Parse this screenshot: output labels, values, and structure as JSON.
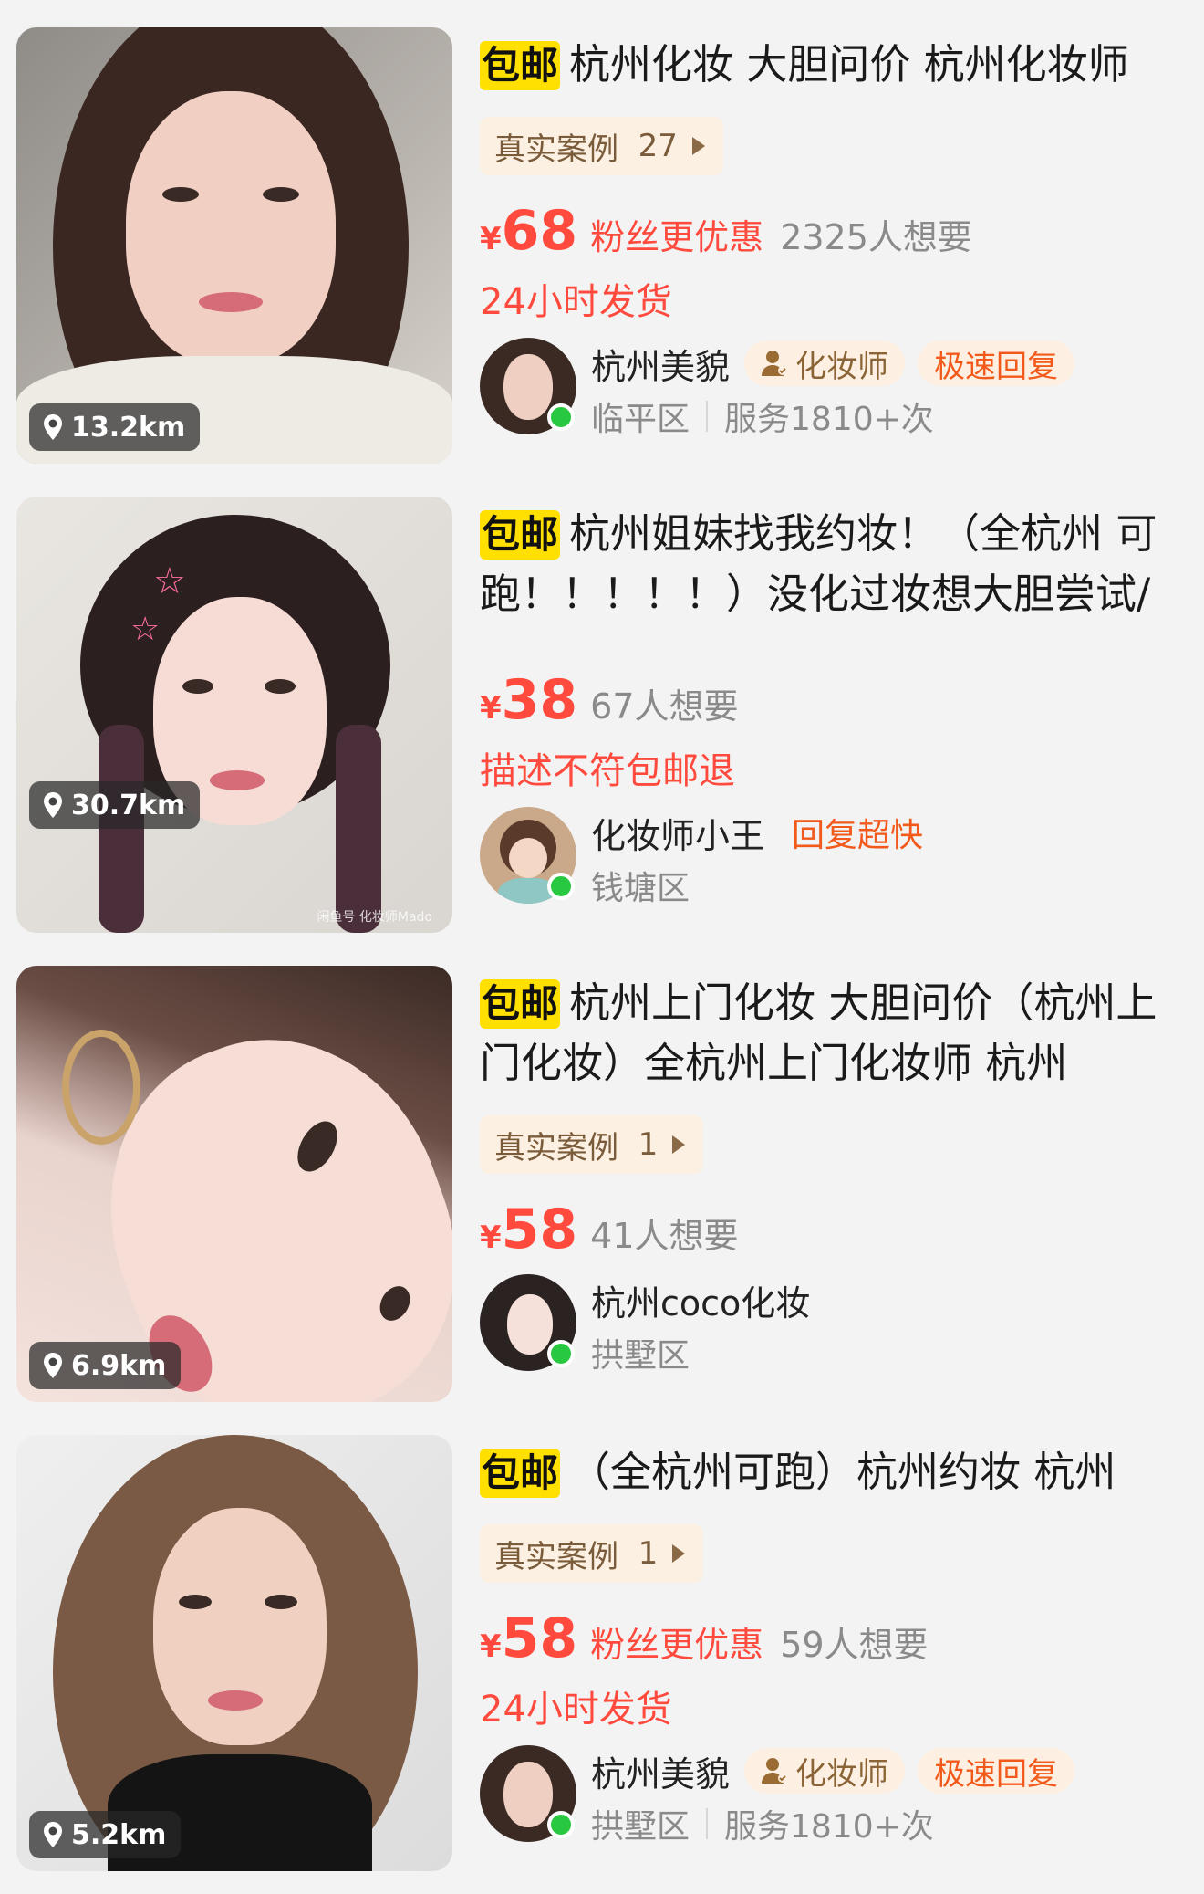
{
  "listings": [
    {
      "distance": "13.2km",
      "free_shipping": "包邮",
      "title": "杭州化妆 大胆问价 杭州化妆师",
      "case": {
        "label": "真实案例",
        "count": "27"
      },
      "price_symbol": "¥",
      "price": "68",
      "fan_deal": "粉丝更优惠",
      "want": "2325人想要",
      "shipping": "24小时发货",
      "seller": {
        "name": "杭州美貌",
        "badge": "化妆师",
        "fast_reply": "极速回复",
        "district": "临平区",
        "service": "服务1810+次"
      }
    },
    {
      "distance": "30.7km",
      "free_shipping": "包邮",
      "title": "杭州姐妹找我约妆！（全杭州 可跑！！！！！）没化过妆想大胆尝试/不",
      "price_symbol": "¥",
      "price": "38",
      "want": "67人想要",
      "shipping": "描述不符包邮退",
      "seller": {
        "name": "化妆师小王",
        "quick_reply": "回复超快",
        "district": "钱塘区"
      },
      "watermark": "闲鱼号 化妆师Mado"
    },
    {
      "distance": "6.9km",
      "free_shipping": "包邮",
      "title": "杭州上门化妆 大胆问价（杭州上门化妆）全杭州上门化妆师  杭州",
      "case": {
        "label": "真实案例",
        "count": "1"
      },
      "price_symbol": "¥",
      "price": "58",
      "want": "41人想要",
      "seller": {
        "name": "杭州coco化妆",
        "district": "拱墅区"
      }
    },
    {
      "distance": "5.2km",
      "free_shipping": "包邮",
      "title": "（全杭州可跑）杭州约妆  杭州",
      "case": {
        "label": "真实案例",
        "count": "1"
      },
      "price_symbol": "¥",
      "price": "58",
      "fan_deal": "粉丝更优惠",
      "want": "59人想要",
      "shipping": "24小时发货",
      "seller": {
        "name": "杭州美貌",
        "badge": "化妆师",
        "fast_reply": "极速回复",
        "district": "拱墅区",
        "service": "服务1810+次"
      }
    }
  ],
  "icons": {
    "location": "location-pin-icon",
    "play": "play-triangle-icon",
    "person": "person-badge-icon"
  },
  "colors": {
    "price": "#ff4a3d",
    "free_tag": "#ffe000",
    "badge_bg": "#fdf0e2",
    "online": "#28c840"
  }
}
